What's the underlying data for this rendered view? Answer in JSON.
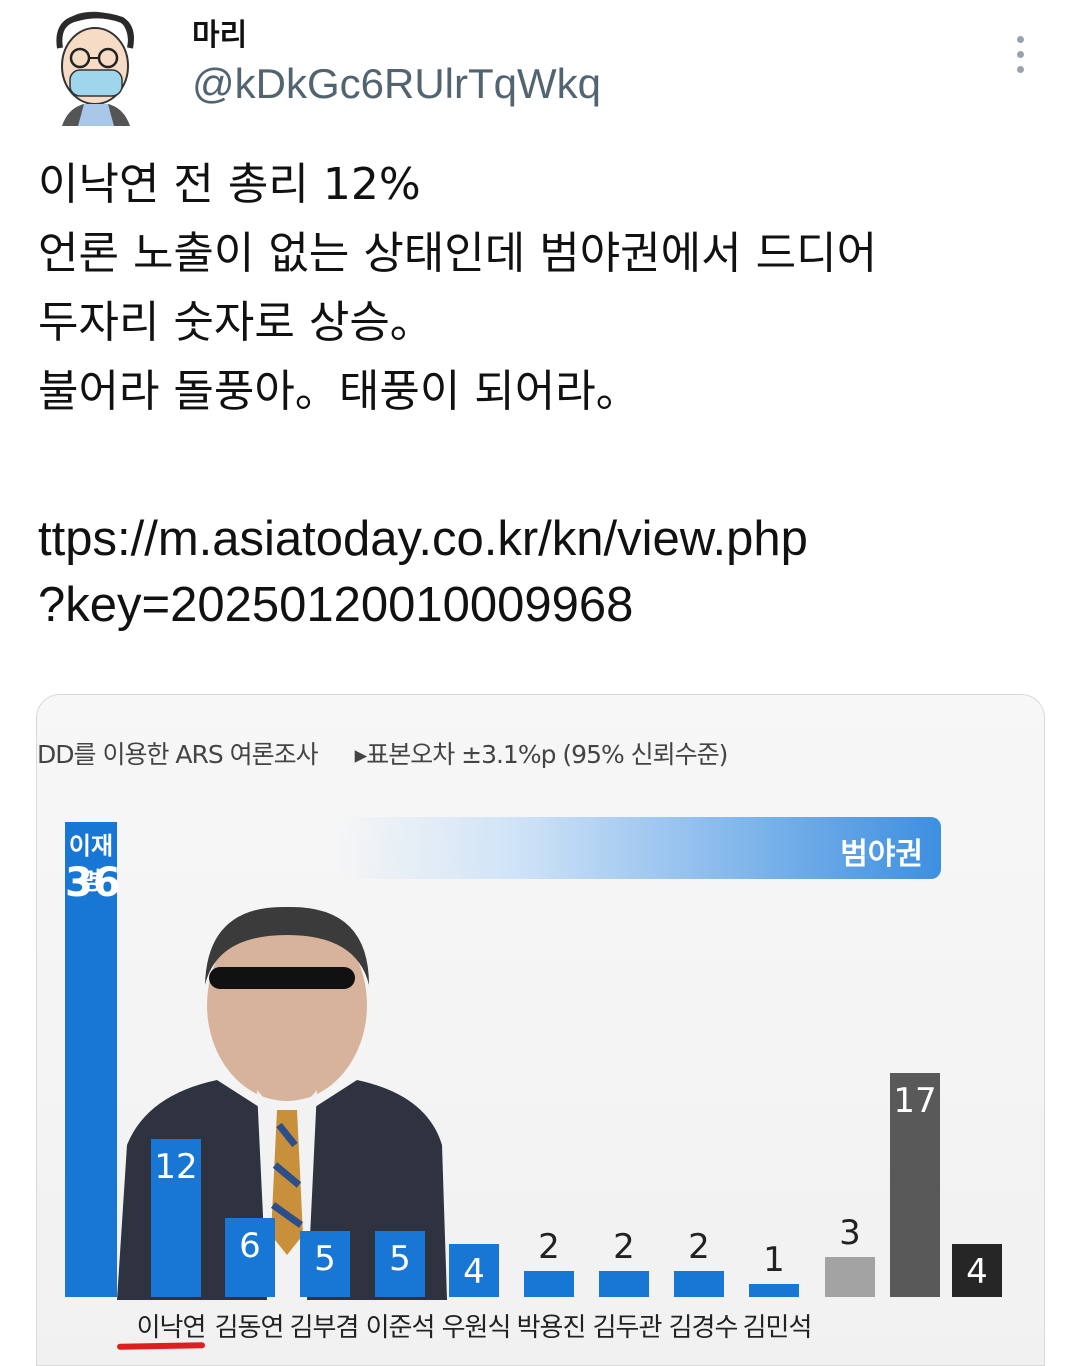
{
  "tweet": {
    "display_name": "마리",
    "handle": "@kDkGc6RUlrTqWkq",
    "text_lines": [
      "이낙연 전 총리 12%",
      "언론 노출이 없는 상태인데 범야권에서  드디어",
      "두자리 숫자로 상승。",
      "불어라 돌풍아。태풍이 되어라。"
    ],
    "link_lines": [
      "ttps://m.asiatoday.co.kr/kn/view.php",
      "?key=20250120010009968"
    ]
  },
  "icons": {
    "avatar": "masked-person-avatar",
    "more": "vertical-ellipsis-icon"
  },
  "chart_header": {
    "left": "DD를 이용한 ARS 여론조사",
    "right": "▸표본오차 ±3.1%p (95% 신뢰수준)"
  },
  "opposition_label": "범야권",
  "top_bar_name": "이재명",
  "colors": {
    "blue_bar": "#1877d4",
    "gray_bar": "#a3a3a3",
    "dark_bar": "#595959",
    "black_bar": "#262626",
    "underline": "#e01e1e",
    "handle": "#536471"
  },
  "chart_data": {
    "type": "bar",
    "title": "",
    "xlabel": "",
    "ylabel": "",
    "ylim": [
      0,
      36
    ],
    "grid": false,
    "categories": [
      "이재명",
      "이낙연",
      "김동연",
      "김부겸",
      "이준석",
      "우원식",
      "박용진",
      "김두관",
      "김경수",
      "김민석",
      "",
      "",
      ""
    ],
    "category_labels_shown": [
      "이낙연",
      "김동연",
      "김부겸",
      "이준석",
      "우원식",
      "박용진",
      "김두관",
      "김경수",
      "김민석"
    ],
    "values": [
      36,
      12,
      6,
      5,
      5,
      4,
      2,
      2,
      2,
      1,
      3,
      17,
      4
    ],
    "bar_colors": [
      "blue",
      "blue",
      "blue",
      "blue",
      "blue",
      "blue",
      "blue",
      "blue",
      "blue",
      "blue",
      "gray",
      "dark",
      "black"
    ]
  }
}
